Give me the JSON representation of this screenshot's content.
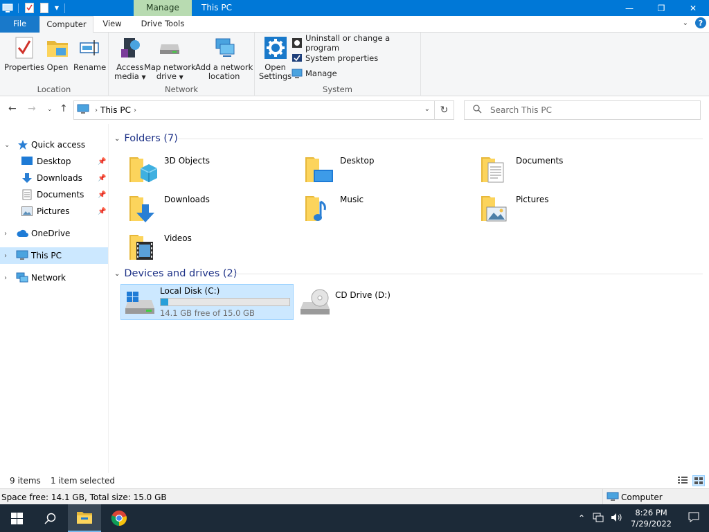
{
  "titlebar": {
    "title": "This PC",
    "context_tab": "Manage",
    "minimize": "—",
    "maximize": "❐",
    "close": "✕"
  },
  "tabs": {
    "file": "File",
    "computer": "Computer",
    "view": "View",
    "drive_tools": "Drive Tools"
  },
  "ribbon": {
    "location": {
      "label": "Location",
      "properties": "Properties",
      "open": "Open",
      "rename": "Rename"
    },
    "network": {
      "label": "Network",
      "access_media_1": "Access",
      "access_media_2": "media",
      "map_drive_1": "Map network",
      "map_drive_2": "drive",
      "add_location_1": "Add a network",
      "add_location_2": "location"
    },
    "system": {
      "label": "System",
      "open_settings_1": "Open",
      "open_settings_2": "Settings",
      "uninstall": "Uninstall or change a program",
      "system_properties": "System properties",
      "manage": "Manage"
    }
  },
  "address": {
    "path": "This PC",
    "search_placeholder": "Search This PC"
  },
  "nav": {
    "quick_access": "Quick access",
    "desktop": "Desktop",
    "downloads": "Downloads",
    "documents": "Documents",
    "pictures": "Pictures",
    "onedrive": "OneDrive",
    "this_pc": "This PC",
    "network": "Network"
  },
  "folders_header": "Folders (7)",
  "folders": [
    "3D Objects",
    "Desktop",
    "Documents",
    "Downloads",
    "Music",
    "Pictures",
    "Videos"
  ],
  "devices_header": "Devices and drives (2)",
  "drives": {
    "c_name": "Local Disk (C:)",
    "c_free": "14.1 GB free of 15.0 GB",
    "c_used_fraction": 0.06,
    "d_name": "CD Drive (D:)"
  },
  "status": {
    "items": "9 items",
    "selected": "1 item selected"
  },
  "infobar": {
    "space": "Space free: 14.1 GB, Total size: 15.0 GB",
    "computer": "Computer"
  },
  "taskbar": {
    "time": "8:26 PM",
    "date": "7/29/2022"
  },
  "colors": {
    "accent": "#0078d7",
    "selection": "#cce8ff",
    "header_text": "#1e3287",
    "drive_bar": "#26a0da"
  }
}
